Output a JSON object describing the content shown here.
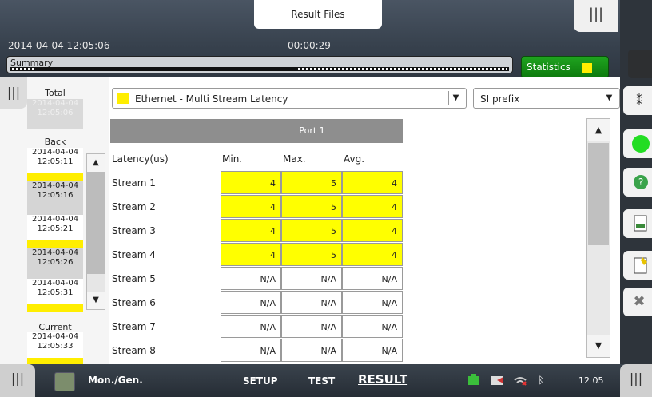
{
  "header": {
    "tab_title": "Result Files",
    "datetime": "2014-04-04 12:05:06",
    "elapsed": "00:00:29",
    "summary_label": "Summary",
    "statistics_label": "Statistics"
  },
  "time_panel": {
    "total_label": "Total",
    "total_time_faded": "2014-04-04",
    "total_time": "12:05:06",
    "back_label": "Back",
    "entries": [
      {
        "date": "2014-04-04",
        "time": "12:05:11"
      },
      {
        "date": "2014-04-04",
        "time": "12:05:16"
      },
      {
        "date": "2014-04-04",
        "time": "12:05:21"
      },
      {
        "date": "2014-04-04",
        "time": "12:05:26"
      },
      {
        "date": "2014-04-04",
        "time": "12:05:31"
      }
    ],
    "current_label": "Current",
    "current_date": "2014-04-04",
    "current_time": "12:05:33"
  },
  "main": {
    "test_select": "Ethernet - Multi Stream Latency",
    "prefix_select": "SI prefix",
    "port_label": "Port 1",
    "columns": {
      "name": "Latency(us)",
      "min": "Min.",
      "max": "Max.",
      "avg": "Avg."
    },
    "rows": [
      {
        "name": "Stream 1",
        "min": "4",
        "max": "5",
        "avg": "4",
        "highlight": true
      },
      {
        "name": "Stream 2",
        "min": "4",
        "max": "5",
        "avg": "4",
        "highlight": true
      },
      {
        "name": "Stream 3",
        "min": "4",
        "max": "5",
        "avg": "4",
        "highlight": true
      },
      {
        "name": "Stream 4",
        "min": "4",
        "max": "5",
        "avg": "4",
        "highlight": true
      },
      {
        "name": "Stream 5",
        "min": "N/A",
        "max": "N/A",
        "avg": "N/A",
        "highlight": false
      },
      {
        "name": "Stream 6",
        "min": "N/A",
        "max": "N/A",
        "avg": "N/A",
        "highlight": false
      },
      {
        "name": "Stream 7",
        "min": "N/A",
        "max": "N/A",
        "avg": "N/A",
        "highlight": false
      },
      {
        "name": "Stream 8",
        "min": "N/A",
        "max": "N/A",
        "avg": "N/A",
        "highlight": false
      }
    ]
  },
  "bottom": {
    "mon_label": "Mon./Gen.",
    "nav_setup": "SETUP",
    "nav_test": "TEST",
    "nav_result": "RESULT",
    "clock": "12 05"
  },
  "icons": {
    "right_panel": [
      "traffic-light-icon",
      "status-led-icon",
      "help-icon",
      "report-icon",
      "edit-report-icon",
      "close-icon"
    ],
    "status": [
      "battery-charging-icon",
      "usb-icon",
      "wifi-icon",
      "bluetooth-icon"
    ]
  },
  "colors": {
    "highlight": "#ffff00",
    "stats_green": "#1fa31f",
    "led_green": "#22dd22"
  }
}
